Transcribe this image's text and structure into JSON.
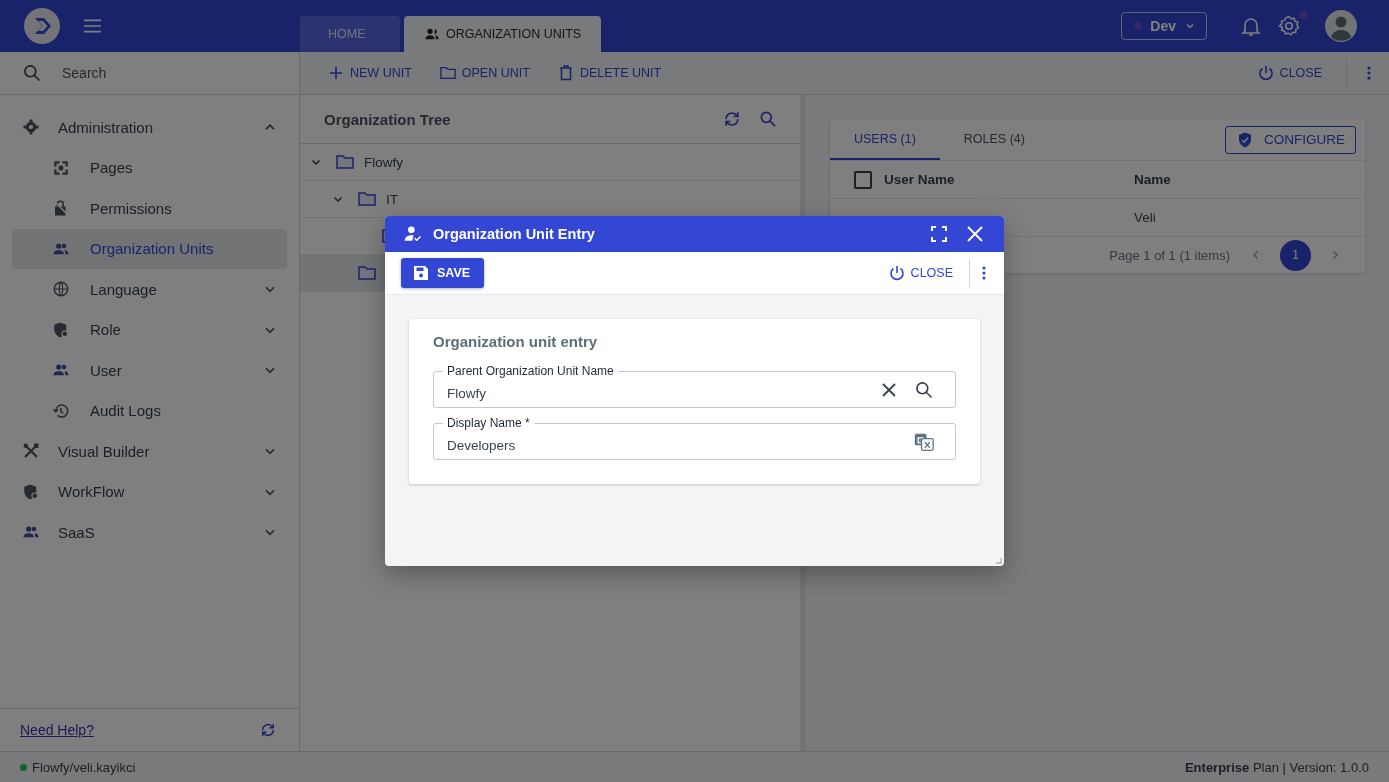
{
  "top_bar": {
    "tabs": [
      {
        "label": "HOME",
        "selected": false
      },
      {
        "label": "ORGANIZATION UNITS",
        "selected": true
      }
    ],
    "environment": {
      "label": "Dev"
    },
    "settings_badge": true
  },
  "sidebar": {
    "search": {
      "placeholder": "Search"
    },
    "items": [
      {
        "label": "Administration",
        "expanded": true,
        "selected": false,
        "children": [
          {
            "label": "Pages",
            "selected": false
          },
          {
            "label": "Permissions",
            "selected": false
          },
          {
            "label": "Organization Units",
            "selected": true
          },
          {
            "label": "Language",
            "selected": false,
            "expanded": false
          },
          {
            "label": "Role",
            "selected": false,
            "expanded": false
          },
          {
            "label": "User",
            "selected": false,
            "expanded": false
          },
          {
            "label": "Audit Logs",
            "selected": false
          }
        ]
      },
      {
        "label": "Visual Builder",
        "expanded": false,
        "selected": false
      },
      {
        "label": "WorkFlow",
        "expanded": false,
        "selected": false
      },
      {
        "label": "SaaS",
        "expanded": false,
        "selected": false
      }
    ],
    "help_link": "Need Help?"
  },
  "toolbar": {
    "buttons": [
      "NEW UNIT",
      "OPEN UNIT",
      "DELETE UNIT"
    ],
    "close": "CLOSE"
  },
  "tree": {
    "title": "Organization Tree",
    "nodes": [
      {
        "label": "Flowfy",
        "expanded": true,
        "selected": false,
        "children": [
          {
            "label": "IT",
            "expanded": true,
            "selected": false,
            "children": [
              {
                "selected": false
              }
            ]
          },
          {
            "selected": true
          }
        ]
      }
    ]
  },
  "members": {
    "tabs": [
      {
        "label": "USERS (1)",
        "selected": true
      },
      {
        "label": "ROLES (4)",
        "selected": false
      }
    ],
    "configure": "CONFIGURE",
    "select_all": {
      "checked": false
    },
    "columns": [
      "User Name",
      "Name"
    ],
    "rows": [
      {
        "name": "Veli"
      }
    ],
    "pager": {
      "summary": "Page 1 of 1 (1 items)",
      "pages": [
        {
          "label": "1",
          "selected": true
        }
      ]
    }
  },
  "dialog": {
    "title": "Organization Unit Entry",
    "save": "SAVE",
    "close": "CLOSE",
    "section_title": "Organization unit entry",
    "fields": [
      {
        "kind": "lookup",
        "label": "Parent Organization Unit Name",
        "value": "Flowfy"
      },
      {
        "kind": "translatable",
        "label": "Display Name *",
        "value": "Developers"
      }
    ]
  },
  "status_bar": {
    "user": "Flowfy/veli.kayikci",
    "online": true,
    "plan": "**Enterprise** Plan | Version: 1.0.0"
  }
}
